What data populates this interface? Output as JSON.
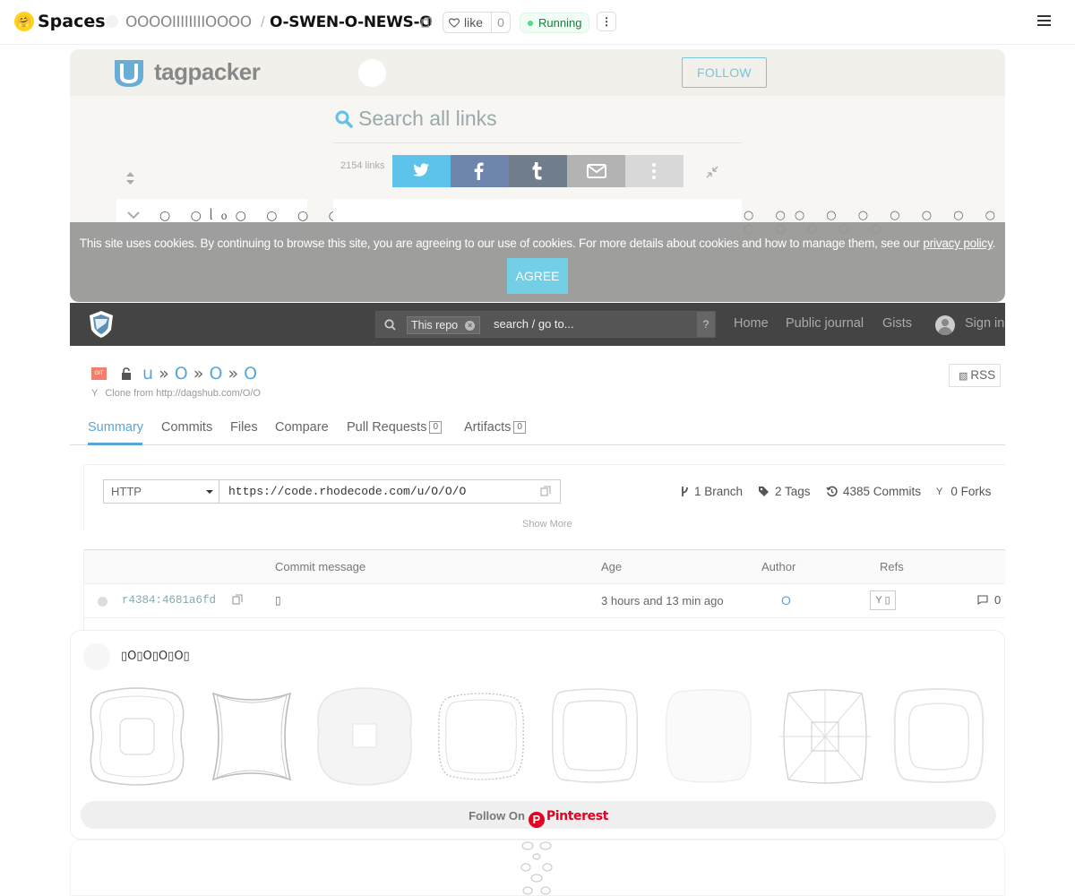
{
  "hf": {
    "logo_emoji": "🤗",
    "spaces_label": "Spaces",
    "owner": "OOOOIIIIIIIIOOOO",
    "slash": "/",
    "repo": "O-SWEN-O-NEWS-O",
    "like_label": "like",
    "like_count": "0",
    "status": "Running",
    "more": "⋮"
  },
  "tagpacker": {
    "brand": "tagpacker",
    "follow": "FOLLOW",
    "search_placeholder": "Search all links",
    "links_count": "2154 links",
    "left_glyphs": "○ ○ᥣᦞ○ ○ ○ ○ᦓᥣ○ ○",
    "row_glyphs": "○ ○○ ○ ○ ○ ○ ○ ○ ○ ○ ○ ○ ○",
    "share_colors": [
      "#5ec3eb",
      "#6e85ad",
      "#707d8a",
      "#b3b3b3",
      "#d8d8d8"
    ],
    "cookie_text": "This site uses cookies. By continuing to browse this site, you are agreeing to our use of cookies. For more details about cookies and how to manage them, see our",
    "cookie_link": "privacy policy",
    "cookie_end": ".",
    "agree": "AGREE"
  },
  "rhodecode": {
    "search_scope": "This repo",
    "search_placeholder": "search / go to...",
    "search_help": "?",
    "nav": [
      "Home",
      "Public journal",
      "Gists",
      "Sign in"
    ],
    "git_badge": "GIT",
    "breadcrumb": [
      "u",
      "O",
      "O",
      "O"
    ],
    "breadcrumb_sep": "»",
    "clone_from": "Clone from http://dagshub.com/O/O",
    "rss": "RSS",
    "tabs": [
      {
        "label": "Summary"
      },
      {
        "label": "Commits"
      },
      {
        "label": "Files"
      },
      {
        "label": "Compare"
      },
      {
        "label": "Pull Requests",
        "count": "0"
      },
      {
        "label": "Artifacts",
        "count": "0"
      }
    ],
    "protocol": "HTTP",
    "clone_url": "https://code.rhodecode.com/u/O/O/O",
    "stats": {
      "branches": "1 Branch",
      "tags": "2 Tags",
      "commits": "4385 Commits",
      "forks": "0 Forks"
    },
    "show_more": "Show More",
    "columns": [
      "Commit message",
      "Age",
      "Author",
      "Refs"
    ],
    "rows": [
      {
        "hash": "r4384:4681a6fd",
        "message": "▯",
        "age": "3 hours and 13 min ago",
        "author": "O",
        "ref": "Y ▯",
        "comments": "0"
      }
    ]
  },
  "pinterest": {
    "user_name": "▯O▯O▯O▯O▯",
    "follow_on": "Follow On",
    "brand": "Pinterest",
    "brand_p": "P"
  }
}
